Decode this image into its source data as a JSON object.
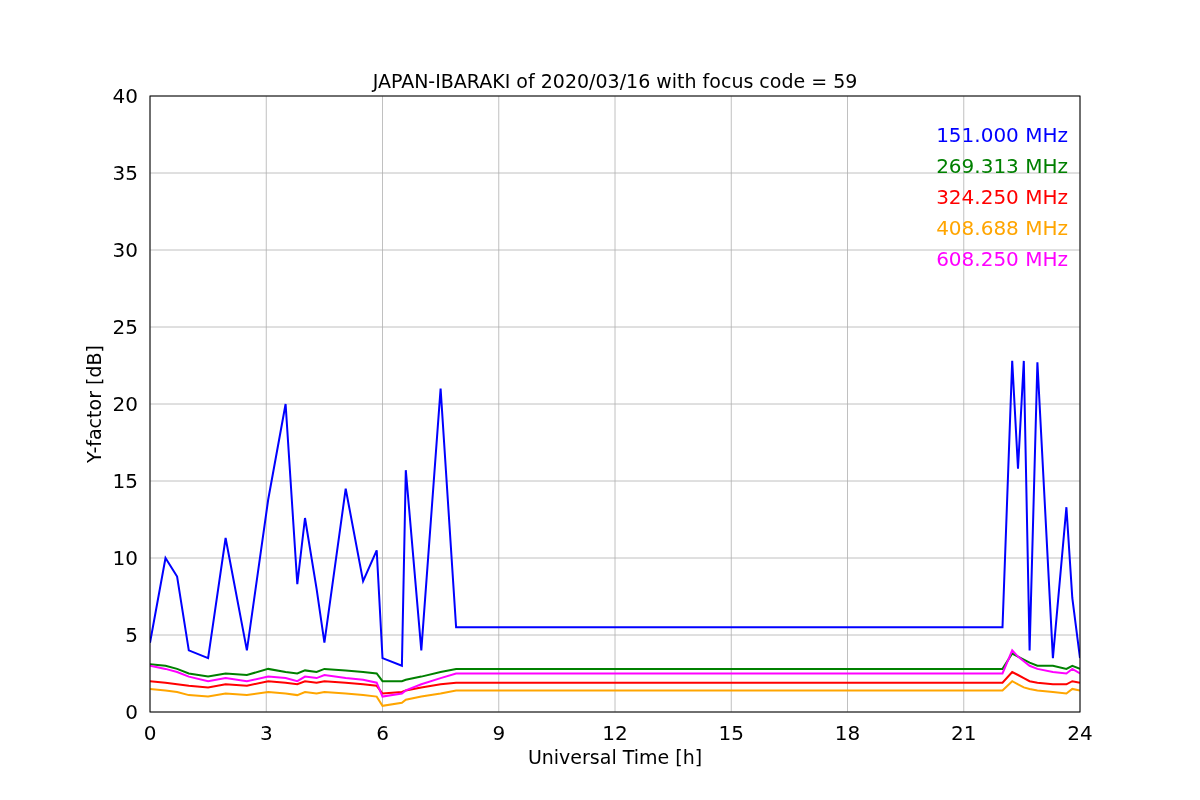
{
  "chart_data": {
    "type": "line",
    "title": "JAPAN-IBARAKI of 2020/03/16 with focus code = 59",
    "xlabel": "Universal Time [h]",
    "ylabel": "Y-factor [dB]",
    "x": [
      0,
      0.4,
      0.7,
      1,
      1.5,
      1.95,
      2.5,
      3.05,
      3.5,
      3.8,
      4,
      4.3,
      4.5,
      5.05,
      5.5,
      5.85,
      6,
      6.5,
      6.6,
      7,
      7.5,
      7.9,
      8,
      15,
      22,
      22.25,
      22.4,
      22.55,
      22.7,
      22.9,
      23.3,
      23.65,
      23.8,
      24
    ],
    "series": [
      {
        "name": "151.000 MHz",
        "color": "#0000ff",
        "values": [
          4.5,
          10,
          8.8,
          4,
          3.5,
          11.3,
          4,
          13.8,
          20,
          8.3,
          12.6,
          8,
          4.5,
          14.5,
          8.5,
          10.5,
          3.5,
          3,
          15.7,
          4,
          21,
          5.5,
          5.5,
          5.5,
          5.5,
          22.8,
          15.8,
          22.8,
          4,
          22.7,
          3.5,
          13.3,
          7.4,
          3.5
        ]
      },
      {
        "name": "269.313 MHz",
        "color": "#008000",
        "values": [
          3.1,
          3,
          2.8,
          2.5,
          2.3,
          2.5,
          2.4,
          2.8,
          2.6,
          2.5,
          2.7,
          2.6,
          2.8,
          2.7,
          2.6,
          2.5,
          2,
          2,
          2.1,
          2.3,
          2.6,
          2.8,
          2.8,
          2.8,
          2.8,
          3.8,
          3.6,
          3.4,
          3.2,
          3,
          3,
          2.8,
          3,
          2.8
        ]
      },
      {
        "name": "324.250 MHz",
        "color": "#ff0000",
        "values": [
          2,
          1.9,
          1.8,
          1.7,
          1.6,
          1.8,
          1.7,
          2,
          1.9,
          1.8,
          2,
          1.9,
          2,
          1.9,
          1.8,
          1.7,
          1.2,
          1.3,
          1.4,
          1.6,
          1.8,
          1.9,
          1.9,
          1.9,
          1.9,
          2.6,
          2.4,
          2.2,
          2,
          1.9,
          1.8,
          1.8,
          2,
          1.9
        ]
      },
      {
        "name": "408.688 MHz",
        "color": "#ffa500",
        "values": [
          1.5,
          1.4,
          1.3,
          1.1,
          1,
          1.2,
          1.1,
          1.3,
          1.2,
          1.1,
          1.3,
          1.2,
          1.3,
          1.2,
          1.1,
          1,
          0.4,
          0.6,
          0.8,
          1,
          1.2,
          1.4,
          1.4,
          1.4,
          1.4,
          2,
          1.8,
          1.6,
          1.5,
          1.4,
          1.3,
          1.2,
          1.5,
          1.4
        ]
      },
      {
        "name": "608.250 MHz",
        "color": "#ff00ff",
        "values": [
          3,
          2.8,
          2.6,
          2.3,
          2,
          2.2,
          2,
          2.3,
          2.2,
          2,
          2.3,
          2.2,
          2.4,
          2.2,
          2.1,
          1.9,
          1,
          1.2,
          1.4,
          1.8,
          2.2,
          2.5,
          2.5,
          2.5,
          2.5,
          4,
          3.6,
          3.3,
          3,
          2.8,
          2.6,
          2.5,
          2.8,
          2.5
        ]
      }
    ],
    "xlim": [
      0,
      24
    ],
    "ylim": [
      0,
      40
    ],
    "xticks": [
      0,
      3,
      6,
      9,
      12,
      15,
      18,
      21,
      24
    ],
    "yticks": [
      0,
      5,
      10,
      15,
      20,
      25,
      30,
      35,
      40
    ],
    "grid": true
  }
}
